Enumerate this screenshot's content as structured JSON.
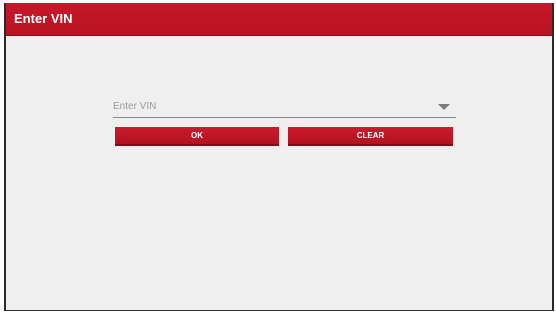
{
  "window": {
    "title": "Enter VIN"
  },
  "vin_input": {
    "placeholder": "Enter VIN",
    "value": "",
    "dropdown_icon": "chevron-down-triangle"
  },
  "buttons": {
    "ok_label": "OK",
    "clear_label": "CLEAR"
  },
  "colors": {
    "accent": "#c8182c",
    "background": "#efefef"
  }
}
